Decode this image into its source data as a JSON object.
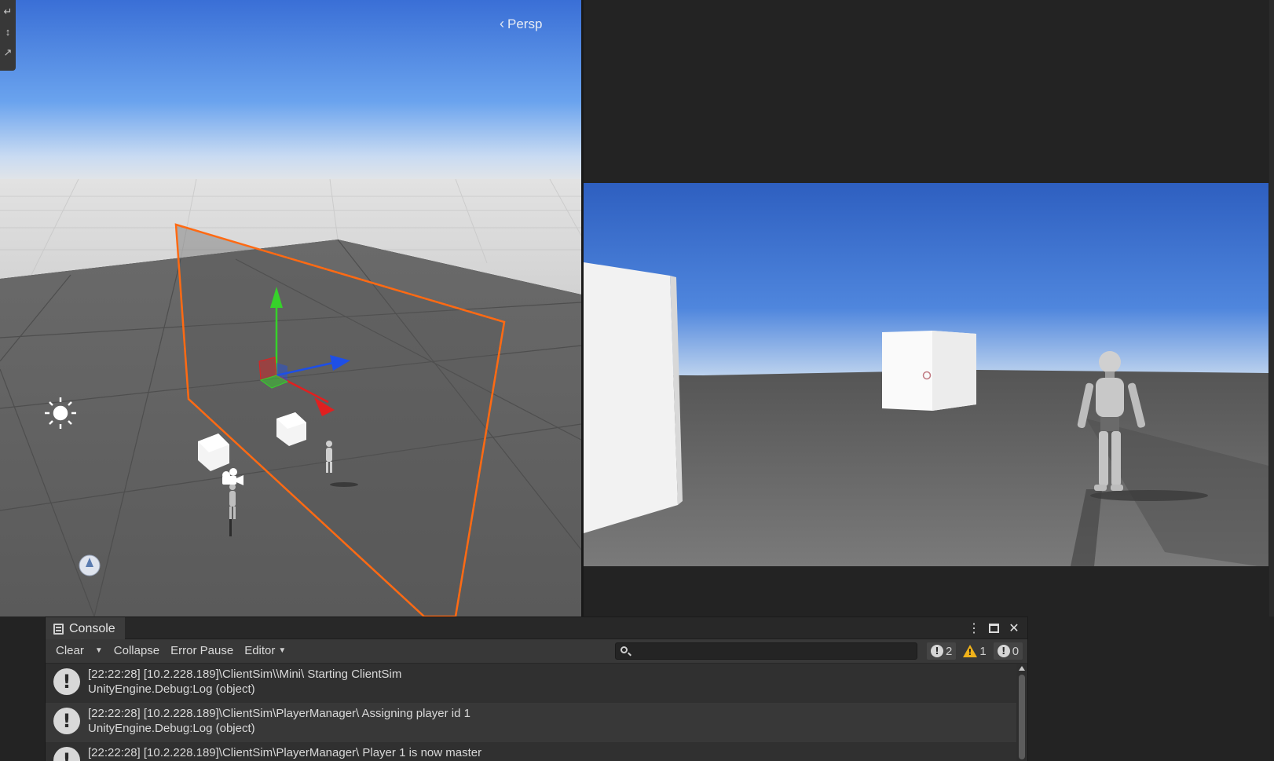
{
  "scene_view": {
    "projection_label": "Persp",
    "projection_icon": "chevron-left-icon",
    "tools": [
      "move-tool-icon",
      "rotate-tool-icon",
      "scale-tool-icon"
    ]
  },
  "game_view": {},
  "console": {
    "tab_label": "Console",
    "toolbar": {
      "clear_label": "Clear",
      "collapse_label": "Collapse",
      "error_pause_label": "Error Pause",
      "editor_label": "Editor",
      "search_placeholder": ""
    },
    "counters": {
      "log": "2",
      "warning": "1",
      "error": "0"
    },
    "entries": [
      {
        "line1": "[22:22:28] [10.2.228.189]\\ClientSim\\\\Mini\\ Starting ClientSim",
        "line2": "UnityEngine.Debug:Log (object)"
      },
      {
        "line1": "[22:22:28] [10.2.228.189]\\ClientSim\\PlayerManager\\ Assigning player id 1",
        "line2": "UnityEngine.Debug:Log (object)"
      },
      {
        "line1": "[22:22:28] [10.2.228.189]\\ClientSim\\PlayerManager\\ Player 1 is now master",
        "line2": ""
      }
    ]
  },
  "colors": {
    "selection_outline": "#ff6a13",
    "gizmo_x": "#e02020",
    "gizmo_y": "#36d12a",
    "gizmo_z": "#1e4fe6",
    "sky_top": "#3c73d8",
    "warning": "#f0b21a"
  }
}
